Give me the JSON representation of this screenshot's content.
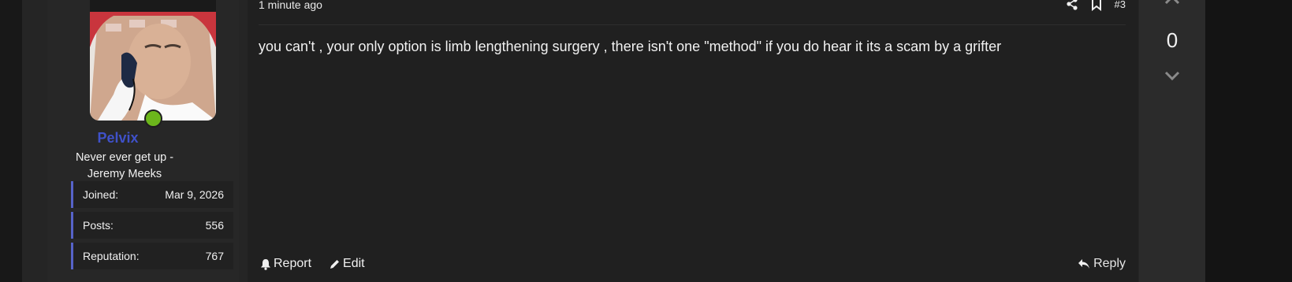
{
  "user": {
    "username": "Pelvix",
    "title": "Never ever get up - Jeremy Meeks",
    "stats": [
      {
        "label": "Joined:",
        "value": "Mar 9, 2026"
      },
      {
        "label": "Posts:",
        "value": "556"
      },
      {
        "label": "Reputation:",
        "value": "767"
      }
    ],
    "online_color": "#6cb61c",
    "name_color": "#3f51c9"
  },
  "post": {
    "time": "1 minute ago",
    "number": "#3",
    "body": "you can't , your only option is limb lengthening surgery , there isn't one \"method\" if you do hear it its a scam by a grifter",
    "icons": [
      "share-icon",
      "bookmark-icon"
    ]
  },
  "actions": {
    "report_label": "Report",
    "edit_label": "Edit",
    "reply_label": "Reply"
  },
  "vote": {
    "count": "0"
  }
}
